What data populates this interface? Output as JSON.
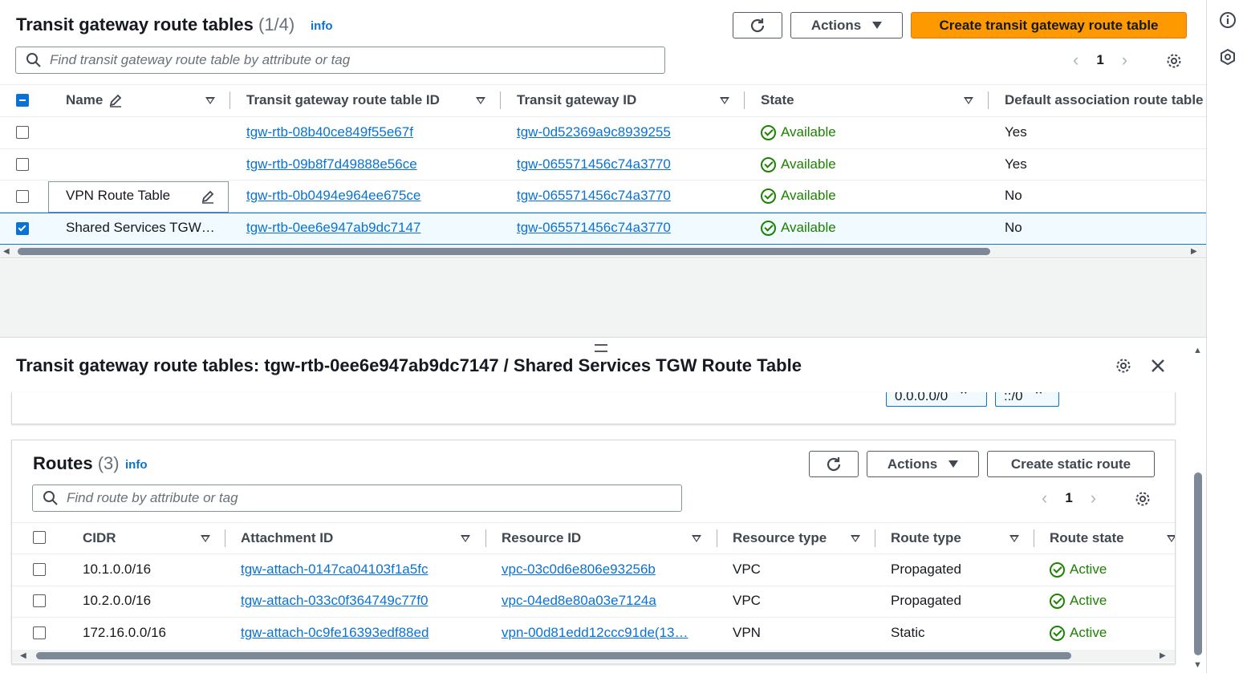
{
  "top": {
    "title": "Transit gateway route tables",
    "count": "(1/4)",
    "info": "info",
    "actions_label": "Actions",
    "create_label": "Create transit gateway route table",
    "search_placeholder": "Find transit gateway route table by attribute or tag",
    "page": "1",
    "columns": [
      "Name",
      "Transit gateway route table ID",
      "Transit gateway ID",
      "State",
      "Default association route table"
    ],
    "rows": [
      {
        "name": "",
        "rtb": "tgw-rtb-08b40ce849f55e67f",
        "tgw": "tgw-0d52369a9c8939255",
        "state": "Available",
        "default": "Yes"
      },
      {
        "name": "",
        "rtb": "tgw-rtb-09b8f7d49888e56ce",
        "tgw": "tgw-065571456c74a3770",
        "state": "Available",
        "default": "Yes"
      },
      {
        "name": "VPN Route Table",
        "rtb": "tgw-rtb-0b0494e964ee675ce",
        "tgw": "tgw-065571456c74a3770",
        "state": "Available",
        "default": "No"
      },
      {
        "name": "Shared Services TGW…",
        "rtb": "tgw-rtb-0ee6e947ab9dc7147",
        "tgw": "tgw-065571456c74a3770",
        "state": "Available",
        "default": "No"
      }
    ]
  },
  "detail": {
    "title": "Transit gateway route tables: tgw-rtb-0ee6e947ab9dc7147 / Shared Services TGW Route Table",
    "tokens": [
      "0.0.0.0/0",
      "::/0"
    ]
  },
  "routes": {
    "title": "Routes",
    "count": "(3)",
    "info": "info",
    "actions_label": "Actions",
    "create_label": "Create static route",
    "search_placeholder": "Find route by attribute or tag",
    "page": "1",
    "columns": [
      "CIDR",
      "Attachment ID",
      "Resource ID",
      "Resource type",
      "Route type",
      "Route state"
    ],
    "rows": [
      {
        "cidr": "10.1.0.0/16",
        "attach": "tgw-attach-0147ca04103f1a5fc",
        "resource": "vpc-03c0d6e806e93256b",
        "rtype": "VPC",
        "route_type": "Propagated",
        "state": "Active"
      },
      {
        "cidr": "10.2.0.0/16",
        "attach": "tgw-attach-033c0f364749c77f0",
        "resource": "vpc-04ed8e80a03e7124a",
        "rtype": "VPC",
        "route_type": "Propagated",
        "state": "Active"
      },
      {
        "cidr": "172.16.0.0/16",
        "attach": "tgw-attach-0c9fe16393edf88ed",
        "resource": "vpn-00d81edd12ccc91de(13…",
        "rtype": "VPN",
        "route_type": "Static",
        "state": "Active"
      }
    ]
  },
  "colors": {
    "accent": "#0972d3",
    "primary": "#ff9900",
    "success": "#1d8102"
  }
}
